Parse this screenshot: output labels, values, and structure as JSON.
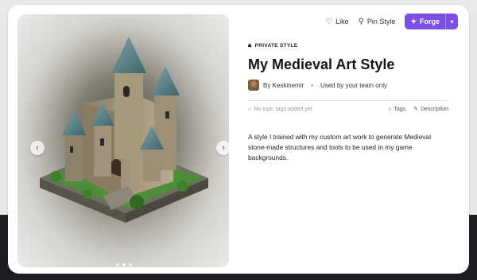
{
  "header": {
    "like_label": "Like",
    "pin_label": "Pin Style",
    "forge_label": "Forge"
  },
  "style": {
    "privacy": "PRIVATE STYLE",
    "title": "My Medieval Art Style",
    "author": "By Keskinemir",
    "usage": "Used by your team only",
    "no_tags": "No topic tags added yet",
    "tags_label": "Tags",
    "description_label": "Description",
    "description": "A style I trained with my custom art work to generate Medieval stone-made structures and tools to be used in my game backgrounds."
  },
  "carousel": {
    "total": 3,
    "active": 2
  },
  "icons": {
    "like": "heart-icon",
    "pin": "pin-icon",
    "forge": "wand-icon",
    "lock": "lock-icon",
    "tag": "tag-icon",
    "edit": "edit-icon"
  },
  "colors": {
    "accent": "#7b4ee6",
    "background_band": "#1f1f23"
  }
}
